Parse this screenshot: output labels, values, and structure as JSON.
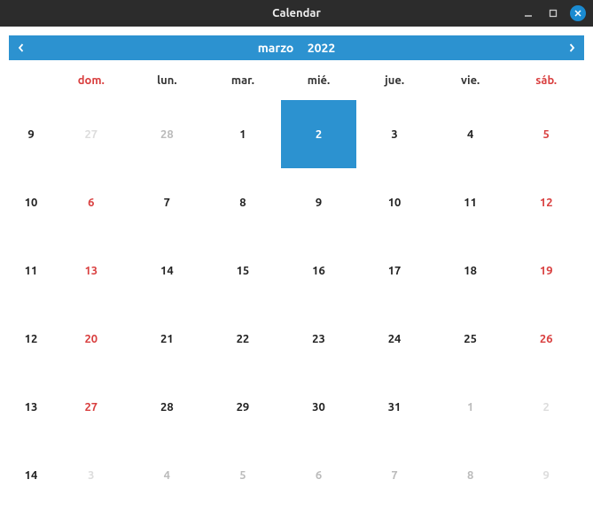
{
  "window": {
    "title": "Calendar"
  },
  "header": {
    "month": "marzo",
    "year": "2022"
  },
  "dow": [
    {
      "label": "dom.",
      "weekend": true
    },
    {
      "label": "lun.",
      "weekend": false
    },
    {
      "label": "mar.",
      "weekend": false
    },
    {
      "label": "mié.",
      "weekend": false
    },
    {
      "label": "jue.",
      "weekend": false
    },
    {
      "label": "vie.",
      "weekend": false
    },
    {
      "label": "sáb.",
      "weekend": true
    }
  ],
  "weeks": [
    {
      "num": "9",
      "days": [
        {
          "d": "27",
          "other": true,
          "weekend": true,
          "sel": false
        },
        {
          "d": "28",
          "other": true,
          "weekend": false,
          "sel": false
        },
        {
          "d": "1",
          "other": false,
          "weekend": false,
          "sel": false
        },
        {
          "d": "2",
          "other": false,
          "weekend": false,
          "sel": true
        },
        {
          "d": "3",
          "other": false,
          "weekend": false,
          "sel": false
        },
        {
          "d": "4",
          "other": false,
          "weekend": false,
          "sel": false
        },
        {
          "d": "5",
          "other": false,
          "weekend": true,
          "sel": false
        }
      ]
    },
    {
      "num": "10",
      "days": [
        {
          "d": "6",
          "other": false,
          "weekend": true,
          "sel": false
        },
        {
          "d": "7",
          "other": false,
          "weekend": false,
          "sel": false
        },
        {
          "d": "8",
          "other": false,
          "weekend": false,
          "sel": false
        },
        {
          "d": "9",
          "other": false,
          "weekend": false,
          "sel": false
        },
        {
          "d": "10",
          "other": false,
          "weekend": false,
          "sel": false
        },
        {
          "d": "11",
          "other": false,
          "weekend": false,
          "sel": false
        },
        {
          "d": "12",
          "other": false,
          "weekend": true,
          "sel": false
        }
      ]
    },
    {
      "num": "11",
      "days": [
        {
          "d": "13",
          "other": false,
          "weekend": true,
          "sel": false
        },
        {
          "d": "14",
          "other": false,
          "weekend": false,
          "sel": false
        },
        {
          "d": "15",
          "other": false,
          "weekend": false,
          "sel": false
        },
        {
          "d": "16",
          "other": false,
          "weekend": false,
          "sel": false
        },
        {
          "d": "17",
          "other": false,
          "weekend": false,
          "sel": false
        },
        {
          "d": "18",
          "other": false,
          "weekend": false,
          "sel": false
        },
        {
          "d": "19",
          "other": false,
          "weekend": true,
          "sel": false
        }
      ]
    },
    {
      "num": "12",
      "days": [
        {
          "d": "20",
          "other": false,
          "weekend": true,
          "sel": false
        },
        {
          "d": "21",
          "other": false,
          "weekend": false,
          "sel": false
        },
        {
          "d": "22",
          "other": false,
          "weekend": false,
          "sel": false
        },
        {
          "d": "23",
          "other": false,
          "weekend": false,
          "sel": false
        },
        {
          "d": "24",
          "other": false,
          "weekend": false,
          "sel": false
        },
        {
          "d": "25",
          "other": false,
          "weekend": false,
          "sel": false
        },
        {
          "d": "26",
          "other": false,
          "weekend": true,
          "sel": false
        }
      ]
    },
    {
      "num": "13",
      "days": [
        {
          "d": "27",
          "other": false,
          "weekend": true,
          "sel": false
        },
        {
          "d": "28",
          "other": false,
          "weekend": false,
          "sel": false
        },
        {
          "d": "29",
          "other": false,
          "weekend": false,
          "sel": false
        },
        {
          "d": "30",
          "other": false,
          "weekend": false,
          "sel": false
        },
        {
          "d": "31",
          "other": false,
          "weekend": false,
          "sel": false
        },
        {
          "d": "1",
          "other": true,
          "weekend": false,
          "sel": false
        },
        {
          "d": "2",
          "other": true,
          "weekend": true,
          "sel": false
        }
      ]
    },
    {
      "num": "14",
      "days": [
        {
          "d": "3",
          "other": true,
          "weekend": true,
          "sel": false
        },
        {
          "d": "4",
          "other": true,
          "weekend": false,
          "sel": false
        },
        {
          "d": "5",
          "other": true,
          "weekend": false,
          "sel": false
        },
        {
          "d": "6",
          "other": true,
          "weekend": false,
          "sel": false
        },
        {
          "d": "7",
          "other": true,
          "weekend": false,
          "sel": false
        },
        {
          "d": "8",
          "other": true,
          "weekend": false,
          "sel": false
        },
        {
          "d": "9",
          "other": true,
          "weekend": true,
          "sel": false
        }
      ]
    }
  ],
  "colors": {
    "accent": "#2c92d0",
    "weekend": "#d93f3f"
  }
}
